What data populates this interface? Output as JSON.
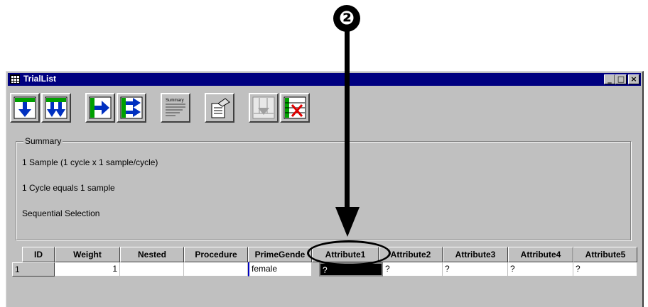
{
  "callout": {
    "number": "❷"
  },
  "window": {
    "title": "TrialList",
    "icon": "grid-icon",
    "controls": {
      "minimize": "_",
      "maximize": "□",
      "close": "×"
    }
  },
  "toolbar": {
    "buttons": [
      {
        "name": "add-level-icon"
      },
      {
        "name": "add-multiple-levels-icon"
      },
      {
        "name": "add-attribute-icon"
      },
      {
        "name": "add-multiple-attributes-icon"
      },
      {
        "name": "summary-icon",
        "label": "Summary"
      },
      {
        "name": "properties-icon"
      },
      {
        "name": "remove-level-icon"
      },
      {
        "name": "remove-attribute-icon"
      }
    ]
  },
  "summary": {
    "legend": "Summary",
    "lines": [
      "1 Sample (1 cycle x 1 sample/cycle)",
      "1 Cycle equals 1 sample",
      "Sequential Selection"
    ]
  },
  "grid": {
    "headers": [
      "ID",
      "Weight",
      "Nested",
      "Procedure",
      "PrimeGende",
      "Attribute1",
      "Attribute2",
      "Attribute3",
      "Attribute4",
      "Attribute5"
    ],
    "rows": [
      [
        "1",
        "1",
        "",
        "",
        "female",
        "?",
        "?",
        "?",
        "?",
        "?"
      ]
    ]
  },
  "colors": {
    "titlebar": "#000080",
    "window": "#c0c0c0",
    "callout": "#000000"
  }
}
